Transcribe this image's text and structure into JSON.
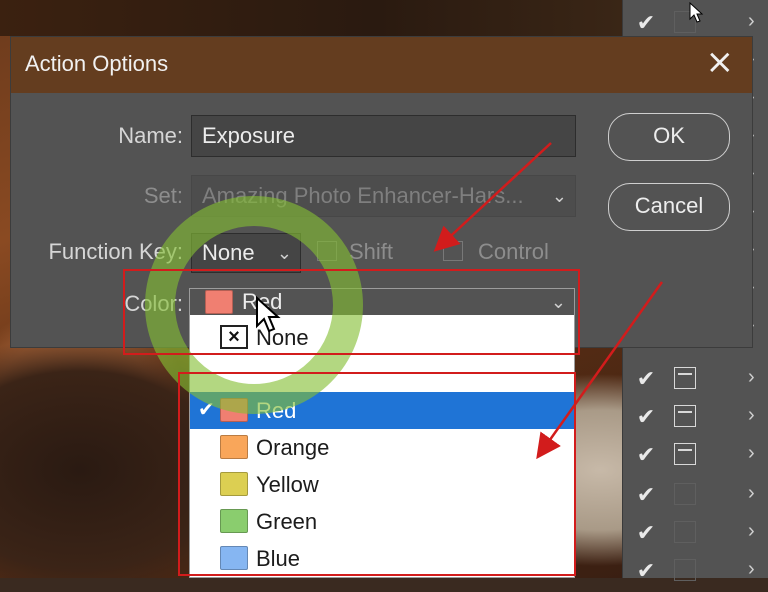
{
  "dialog": {
    "title": "Action Options",
    "name_label": "Name:",
    "name_value": "Exposure",
    "set_label": "Set:",
    "set_value": "Amazing Photo Enhancer-Hars...",
    "function_key_label": "Function Key:",
    "function_key_value": "None",
    "shift_label": "Shift",
    "control_label": "Control",
    "color_label": "Color:",
    "color_value": "Red",
    "ok_label": "OK",
    "cancel_label": "Cancel"
  },
  "color_menu": {
    "options": [
      {
        "label": "None",
        "color": "none",
        "selected": false
      },
      {
        "label": "Red",
        "color": "#f07f71",
        "selected": true
      },
      {
        "label": "Orange",
        "color": "#f9a65a",
        "selected": false
      },
      {
        "label": "Yellow",
        "color": "#dccf52",
        "selected": false
      },
      {
        "label": "Green",
        "color": "#8acd6e",
        "selected": false
      },
      {
        "label": "Blue",
        "color": "#86b6f2",
        "selected": false
      }
    ]
  },
  "colors": {
    "titlebar": "#643d1f",
    "selection": "#1f74d6",
    "annotation_red": "#d21c1c",
    "annotation_green": "#84be34"
  }
}
